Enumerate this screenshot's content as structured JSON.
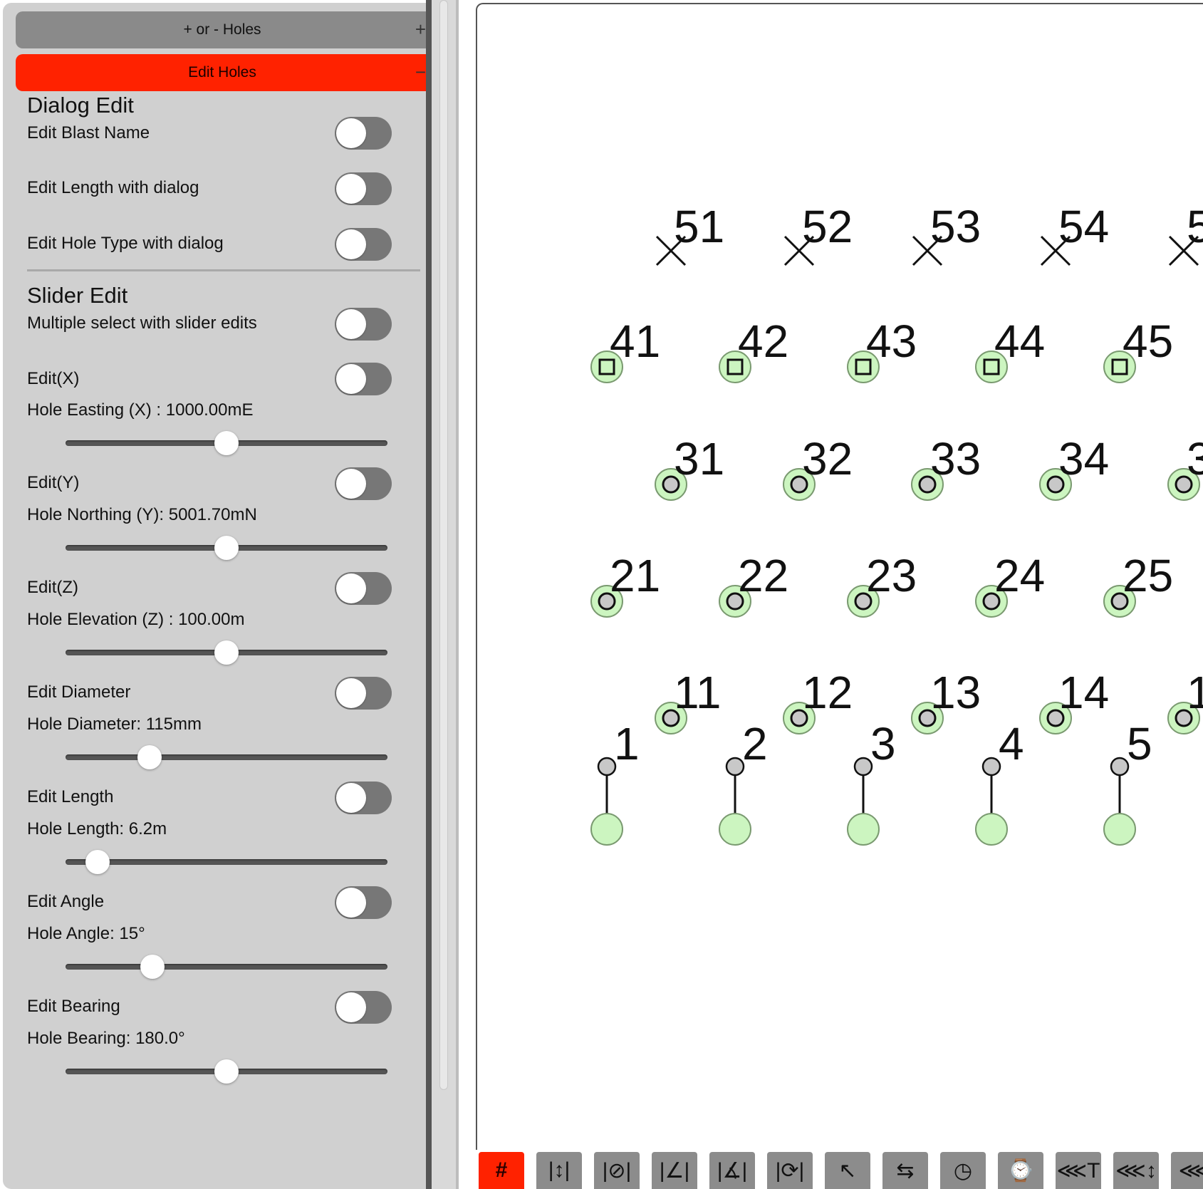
{
  "accordion": {
    "add_remove_label": "+ or - Holes",
    "add_remove_sign": "+",
    "edit_holes_label": "Edit Holes",
    "edit_holes_sign": "−"
  },
  "dialog_edit": {
    "title": "Dialog Edit",
    "rows": [
      {
        "label": "Edit Blast Name",
        "on": false
      },
      {
        "label": "Edit Length with dialog",
        "on": false
      },
      {
        "label": "Edit Hole Type with dialog",
        "on": false
      }
    ]
  },
  "slider_edit": {
    "title": "Slider Edit",
    "multi_select_label": "Multiple select with slider edits",
    "fields": [
      {
        "toggle_label": "Edit(X)",
        "value_label": "Hole Easting (X) : 1000.00mE",
        "level": 0.5
      },
      {
        "toggle_label": "Edit(Y)",
        "value_label": "Hole Northing (Y): 5001.70mN",
        "level": 0.5
      },
      {
        "toggle_label": "Edit(Z)",
        "value_label": "Hole Elevation (Z) : 100.00m",
        "level": 0.5
      },
      {
        "toggle_label": "Edit Diameter",
        "value_label": "Hole Diameter: 115mm",
        "level": 0.26
      },
      {
        "toggle_label": "Edit Length",
        "value_label": "Hole Length: 6.2m",
        "level": 0.1
      },
      {
        "toggle_label": "Edit Angle",
        "value_label": "Hole Angle: 15°",
        "level": 0.27
      },
      {
        "toggle_label": "Edit Bearing",
        "value_label": "Hole Bearing: 180.0°",
        "level": 0.5
      }
    ]
  },
  "canvas": {
    "colors": {
      "collar_fill": "#ccf5c0",
      "collar_stroke": "#7a9a70",
      "toe_fill": "#c8c8c8",
      "line": "#111111"
    },
    "rows": [
      {
        "type": "cross",
        "labels": [
          "51",
          "52",
          "53",
          "54",
          "5"
        ]
      },
      {
        "type": "square",
        "labels": [
          "41",
          "42",
          "43",
          "44",
          "45"
        ]
      },
      {
        "type": "dot",
        "labels": [
          "31",
          "32",
          "33",
          "34",
          "3"
        ]
      },
      {
        "type": "dot",
        "labels": [
          "21",
          "22",
          "23",
          "24",
          "25"
        ]
      },
      {
        "type": "dot",
        "labels": [
          "11",
          "12",
          "13",
          "14",
          "1"
        ]
      },
      {
        "type": "angled",
        "labels": [
          "1",
          "2",
          "3",
          "4",
          "5"
        ]
      }
    ]
  },
  "toolbar": {
    "accent": "#ff2200",
    "buttons": [
      {
        "glyph": "#",
        "icon": "grid-toggle-icon",
        "active": true
      },
      {
        "glyph": "|↕|",
        "icon": "vertical-measure-icon",
        "active": false
      },
      {
        "glyph": "|⊘|",
        "icon": "diameter-icon",
        "active": false
      },
      {
        "glyph": "|∠|",
        "icon": "angle-icon",
        "active": false
      },
      {
        "glyph": "|∡|",
        "icon": "dip-angle-icon",
        "active": false
      },
      {
        "glyph": "|⟳|",
        "icon": "rotation-icon",
        "active": false
      },
      {
        "glyph": "↖",
        "icon": "direction-arrow-icon",
        "active": false
      },
      {
        "glyph": "⇆",
        "icon": "swap-icon",
        "active": false
      },
      {
        "glyph": "◷",
        "icon": "clock-icon",
        "active": false
      },
      {
        "glyph": "⌚",
        "icon": "watch-icon",
        "active": false
      },
      {
        "glyph": "⋘T",
        "icon": "text-size-icon",
        "active": false
      },
      {
        "glyph": "⋘↕",
        "icon": "line-spacing-icon",
        "active": false
      },
      {
        "glyph": "⋘",
        "icon": "more-left-icon",
        "active": false
      }
    ]
  }
}
